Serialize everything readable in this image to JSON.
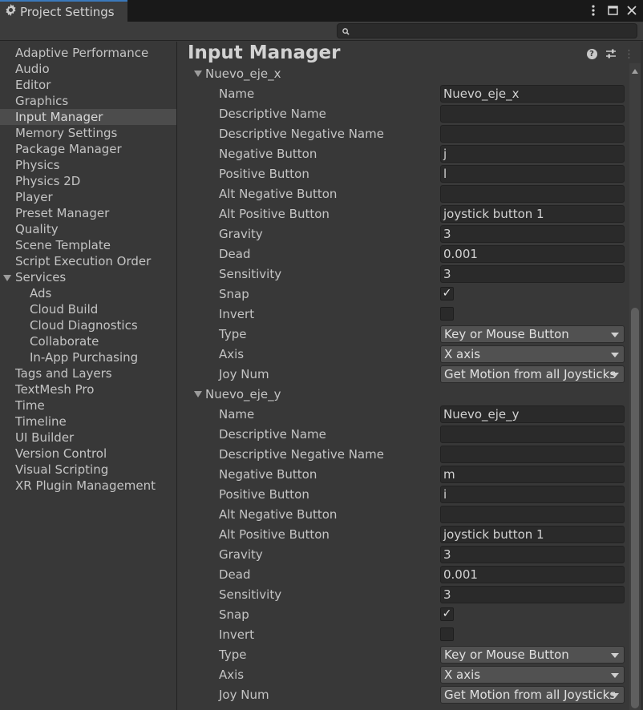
{
  "window": {
    "tab_title": "Project Settings",
    "tab_icon": "gear-icon",
    "controls": [
      "kebab-menu-icon",
      "maximize-icon",
      "close-icon"
    ]
  },
  "search": {
    "placeholder": "",
    "value": ""
  },
  "sidebar": {
    "items": [
      {
        "label": "Adaptive Performance"
      },
      {
        "label": "Audio"
      },
      {
        "label": "Editor"
      },
      {
        "label": "Graphics"
      },
      {
        "label": "Input Manager",
        "selected": true
      },
      {
        "label": "Memory Settings"
      },
      {
        "label": "Package Manager"
      },
      {
        "label": "Physics"
      },
      {
        "label": "Physics 2D"
      },
      {
        "label": "Player"
      },
      {
        "label": "Preset Manager"
      },
      {
        "label": "Quality"
      },
      {
        "label": "Scene Template"
      },
      {
        "label": "Script Execution Order"
      },
      {
        "label": "Services",
        "expanded": true
      },
      {
        "label": "Ads",
        "sub": true
      },
      {
        "label": "Cloud Build",
        "sub": true
      },
      {
        "label": "Cloud Diagnostics",
        "sub": true
      },
      {
        "label": "Collaborate",
        "sub": true
      },
      {
        "label": "In-App Purchasing",
        "sub": true
      },
      {
        "label": "Tags and Layers"
      },
      {
        "label": "TextMesh Pro"
      },
      {
        "label": "Time"
      },
      {
        "label": "Timeline"
      },
      {
        "label": "UI Builder"
      },
      {
        "label": "Version Control"
      },
      {
        "label": "Visual Scripting"
      },
      {
        "label": "XR Plugin Management"
      }
    ]
  },
  "main": {
    "title": "Input Manager",
    "header_icons": [
      "help-icon",
      "preset-sliders-icon",
      "kebab-menu-icon"
    ],
    "labels": {
      "name": "Name",
      "descriptive_name": "Descriptive Name",
      "descriptive_negative_name": "Descriptive Negative Name",
      "negative_button": "Negative Button",
      "positive_button": "Positive Button",
      "alt_negative_button": "Alt Negative Button",
      "alt_positive_button": "Alt Positive Button",
      "gravity": "Gravity",
      "dead": "Dead",
      "sensitivity": "Sensitivity",
      "snap": "Snap",
      "invert": "Invert",
      "type": "Type",
      "axis": "Axis",
      "joy_num": "Joy Num"
    },
    "axes": [
      {
        "header": "Nuevo_eje_x",
        "name": "Nuevo_eje_x",
        "descriptive_name": "",
        "descriptive_negative_name": "",
        "negative_button": "j",
        "positive_button": "l",
        "alt_negative_button": "",
        "alt_positive_button": "joystick button 1",
        "gravity": "3",
        "dead": "0.001",
        "sensitivity": "3",
        "snap": "✓",
        "invert": "",
        "type": "Key or Mouse Button",
        "axis": "X axis",
        "joy_num": "Get Motion from all Joysticks"
      },
      {
        "header": "Nuevo_eje_y",
        "name": "Nuevo_eje_y",
        "descriptive_name": "",
        "descriptive_negative_name": "",
        "negative_button": "m",
        "positive_button": "i",
        "alt_negative_button": "",
        "alt_positive_button": "joystick button 1",
        "gravity": "3",
        "dead": "0.001",
        "sensitivity": "3",
        "snap": "✓",
        "invert": "",
        "type": "Key or Mouse Button",
        "axis": "X axis",
        "joy_num": "Get Motion from all Joysticks"
      }
    ]
  },
  "colors": {
    "background": "#383838",
    "field_bg": "#2a2a2a",
    "dropdown_bg": "#515151",
    "selected_bg": "#4c4c4c",
    "tab_accent": "#3a79bb"
  }
}
